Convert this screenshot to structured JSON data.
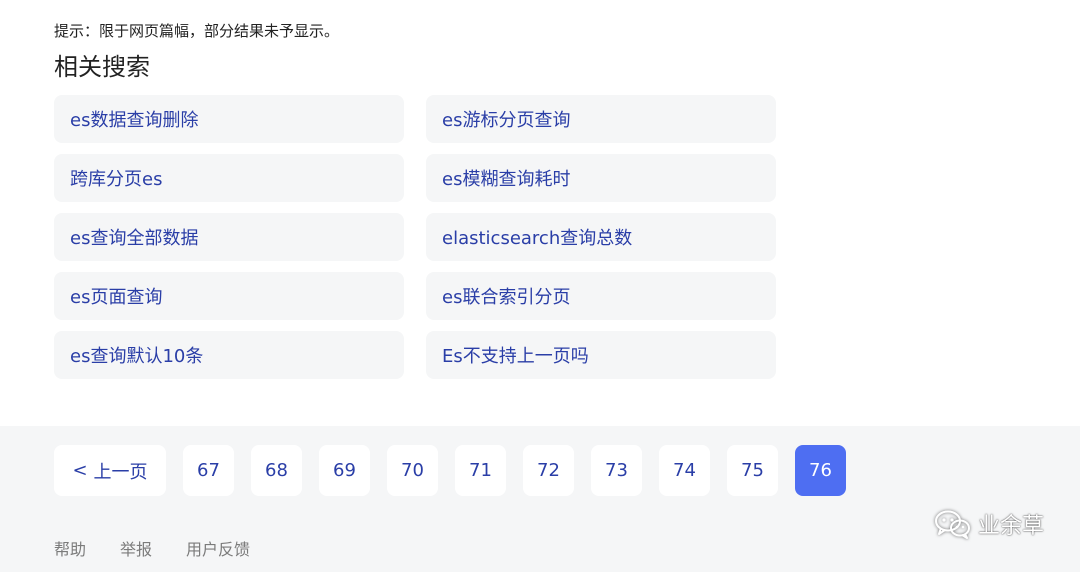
{
  "notice": "提示：限于网页篇幅，部分结果未予显示。",
  "related_title": "相关搜索",
  "related_searches": [
    "es数据查询删除",
    "es游标分页查询",
    "跨库分页es",
    "es模糊查询耗时",
    "es查询全部数据",
    "elasticsearch查询总数",
    "es页面查询",
    "es联合索引分页",
    "es查询默认10条",
    "Es不支持上一页吗"
  ],
  "pagination": {
    "prev_label": "上一页",
    "pages": [
      "67",
      "68",
      "69",
      "70",
      "71",
      "72",
      "73",
      "74",
      "75",
      "76"
    ],
    "current": "76"
  },
  "footer_links": [
    "帮助",
    "举报",
    "用户反馈"
  ],
  "watermark": {
    "text": "业余草",
    "icon": "wechat-icon"
  },
  "colors": {
    "link": "#2a3ea7",
    "active_page": "#4e6ef2",
    "card_bg": "#f5f6f7",
    "footer_text": "#7b7b7b"
  }
}
